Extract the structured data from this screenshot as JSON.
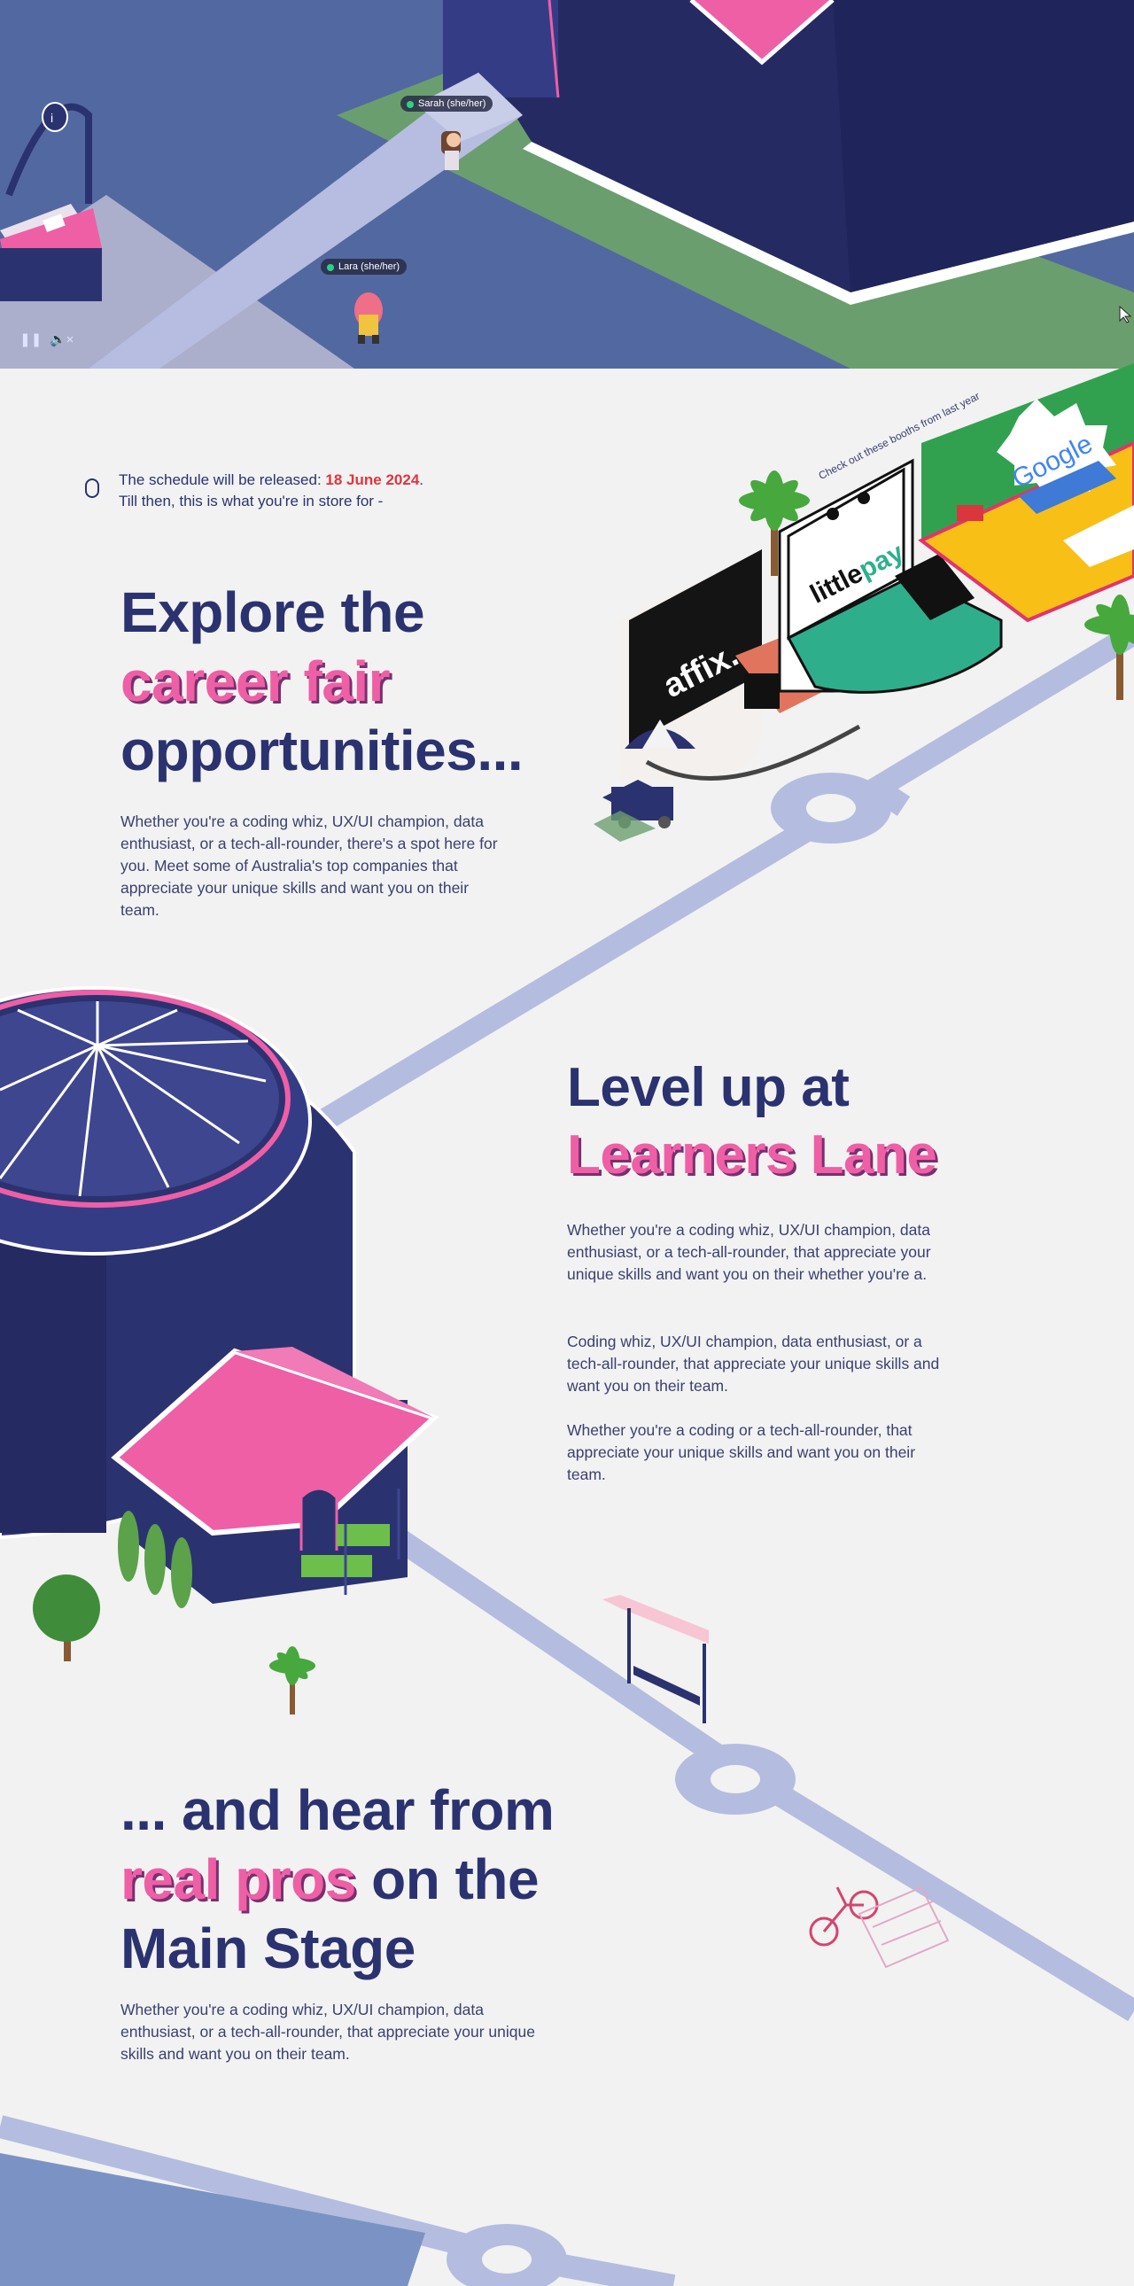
{
  "game": {
    "player_tags": [
      {
        "name": "Sarah (she/her)"
      },
      {
        "name": "Lara (she/her)"
      }
    ],
    "controls": {
      "pause_icon": "pause-icon",
      "mute_icon": "mute-icon"
    }
  },
  "schedule": {
    "line1_prefix": "The schedule will be released: ",
    "date": "18 June 2024",
    "line1_suffix": ".",
    "line2": "Till then, this is what you're in store for -"
  },
  "booths_label": "Check out these booths from last year",
  "sections": {
    "career": {
      "line1": "Explore the",
      "highlight": "career fair",
      "line3": "opportunities...",
      "body": "Whether you're a coding whiz, UX/UI champion, data enthusiast, or a tech-all-rounder, there's a spot here for you. Meet some of Australia's top companies that appreciate your unique skills and want you on their team."
    },
    "learners": {
      "line1": "Level up at",
      "highlight": "Learners Lane",
      "body1": "Whether you're a coding whiz, UX/UI champion, data enthusiast, or a tech-all-rounder,  that appreciate your unique skills and want you on their whether you're a.",
      "body2": "Coding whiz, UX/UI champion, data enthusiast, or a tech-all-rounder,  that appreciate your unique skills and want you on their team.",
      "body3": "Whether you're a coding or a tech-all-rounder, that appreciate your unique skills and want you on their team."
    },
    "stage": {
      "line1": "... and hear from",
      "highlight": "real pros",
      "line2_rest": " on the",
      "line3": "Main Stage",
      "body": "Whether you're a coding whiz, UX/UI champion, data enthusiast, or a tech-all-rounder,  that appreciate your unique skills and want you on their team."
    }
  },
  "brands": {
    "affix": "affix.",
    "littlepay_a": "little",
    "littlepay_b": "pay",
    "google": "Google"
  },
  "colors": {
    "navy": "#2b3270",
    "pink": "#ee5fa6",
    "road": "#b4bde0",
    "grass": "#6b9e6e",
    "date_red": "#e0353c",
    "bg": "#f2f2f2"
  }
}
